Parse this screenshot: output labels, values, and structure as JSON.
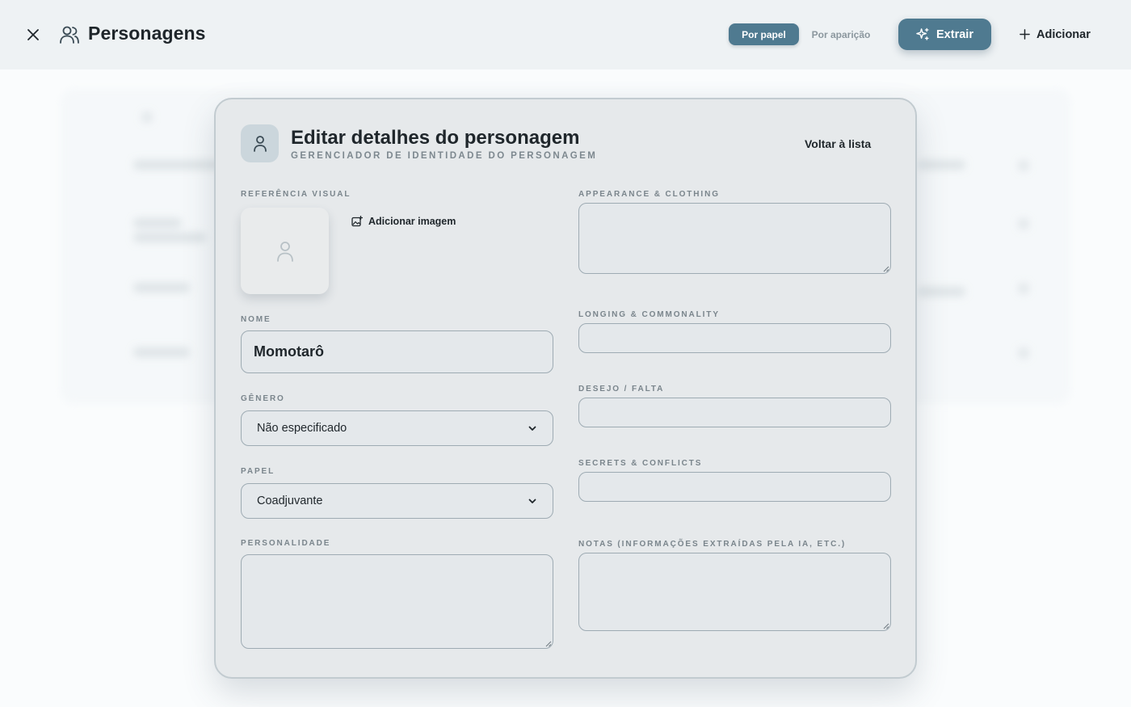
{
  "header": {
    "title": "Personagens",
    "view_by_role": "Por papel",
    "view_by_appearance": "Por aparição",
    "extract_label": "Extrair",
    "add_label": "Adicionar"
  },
  "modal": {
    "title": "Editar detalhes do personagem",
    "subtitle": "GERENCIADOR DE IDENTIDADE DO PERSONAGEM",
    "back_label": "Voltar à lista",
    "visual_ref_label": "REFERÊNCIA VISUAL",
    "add_image_label": "Adicionar imagem",
    "name_label": "NOME",
    "name_value": "Momotarô",
    "gender_label": "GÊNERO",
    "gender_value": "Não especificado",
    "role_label": "PAPEL",
    "role_value": "Coadjuvante",
    "personality_label": "PERSONALIDADE",
    "appearance_label": "APPEARANCE & CLOTHING",
    "longing_label": "LONGING & COMMONALITY",
    "desire_label": "DESEJO / FALTA",
    "secrets_label": "SECRETS & CONFLICTS",
    "notes_label": "NOTAS (INFORMAÇÕES EXTRAÍDAS PELA IA, ETC.)"
  },
  "colors": {
    "accent": "#4f7a90",
    "topbar_bg": "#eef2f4",
    "modal_bg": "#e6e9eb"
  },
  "icons": {
    "close": "close-icon",
    "users": "users-icon",
    "sparkles": "sparkles-icon",
    "plus": "plus-icon",
    "avatar": "user-icon",
    "image_add": "image-add-icon",
    "placeholder": "user-placeholder-icon",
    "chevron": "chevron-down-icon"
  }
}
